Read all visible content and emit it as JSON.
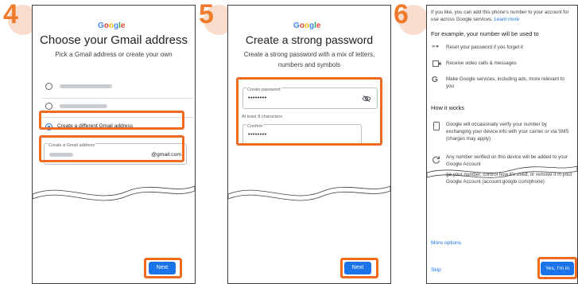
{
  "steps": {
    "s4": "4",
    "s5": "5",
    "s6": "6"
  },
  "panel4": {
    "logo": "Google",
    "title": "Choose your Gmail address",
    "subtitle": "Pick a Gmail address or create your own",
    "option3": "Create a different Gmail address",
    "field_label": "Create a Gmail address",
    "suffix": "@gmail.com",
    "next": "Next"
  },
  "panel5": {
    "logo": "Google",
    "title": "Create a strong password",
    "subtitle": "Create a strong password with a mix of letters, numbers and symbols",
    "pw_label": "Create password",
    "pw_value": "••••••••",
    "hint": "At least 8 characters",
    "confirm_label": "Confirm",
    "confirm_value": "••••••••",
    "next": "Next"
  },
  "panel6": {
    "intro": "If you like, you can add this phone's number to your account for use across Google services.",
    "learn_more": "Learn more",
    "example_heading": "For example, your number will be used to",
    "item1": "Reset your password if you forget it",
    "item2": "Receive video calls & messages",
    "item3": "Make Google services, including ads, more relevant to you",
    "how_heading": "How it works",
    "how1": "Google will occasionally verify your number by exchanging your device info with your carrier or via SMS (charges may apply)",
    "how2a": "Any number verified on this device will be added to your Google Account",
    "how2b": "ge your number, control how it's used, or remove it in your Google Account (account.google.com/phone)",
    "more_options": "More options",
    "skip": "Skip",
    "accept": "Yes, I'm in"
  },
  "colors": {
    "accent_blue": "#1a73e8",
    "highlight_orange": "#f06a23",
    "step_orange": "#f07a2c"
  }
}
